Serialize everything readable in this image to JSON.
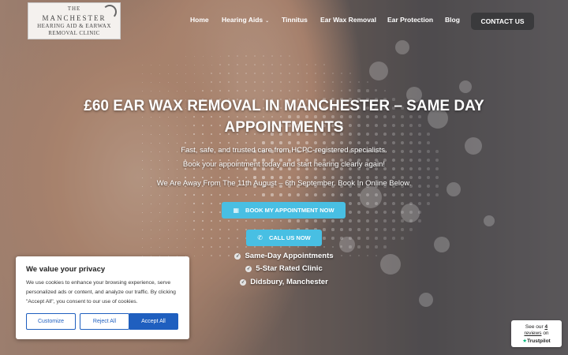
{
  "logo": {
    "line1": "THE",
    "line2": "MANCHESTER",
    "line3": "HEARING AID & EARWAX",
    "line4": "REMOVAL CLINIC"
  },
  "nav": {
    "items": [
      {
        "label": "Home"
      },
      {
        "label": "Hearing Aids",
        "caret": "⌄"
      },
      {
        "label": "Tinnitus"
      },
      {
        "label": "Ear Wax Removal"
      },
      {
        "label": "Ear Protection"
      },
      {
        "label": "Blog"
      }
    ],
    "contact": "CONTACT US"
  },
  "hero": {
    "headline_line1": "£60 EAR WAX REMOVAL IN MANCHESTER – SAME DAY",
    "headline_line2": "APPOINTMENTS",
    "sub1": "Fast, safe, and trusted care from HCPC-registered specialists.",
    "sub2": "Book your appointment today and start hearing clearly again!",
    "notice": "We Are Away From The 11th August – 6th September. Book In Online Below.",
    "book_button": "BOOK MY APPOINTMENT NOW",
    "call_button": "CALL US NOW",
    "features": [
      "Same-Day Appointments",
      "5-Star Rated Clinic",
      "Didsbury, Manchester"
    ]
  },
  "icons": {
    "calendar": "▦",
    "phone": "✆",
    "check": "✓",
    "star": "★"
  },
  "cookie": {
    "title": "We value your privacy",
    "text": "We use cookies to enhance your browsing experience, serve personalized ads or content, and analyze our traffic. By clicking \"Accept All\", you consent to our use of cookies.",
    "customize": "Customize",
    "reject": "Reject All",
    "accept": "Accept All"
  },
  "trustpilot": {
    "see_our": "See our",
    "count": "4",
    "reviews": "reviews",
    "on": "on",
    "brand": "Trustpilot"
  },
  "colors": {
    "accent": "#48bfe3",
    "contact_bg": "#3a3a3c",
    "cookie_button": "#1f5fbf",
    "trustpilot_star": "#00b67a"
  }
}
